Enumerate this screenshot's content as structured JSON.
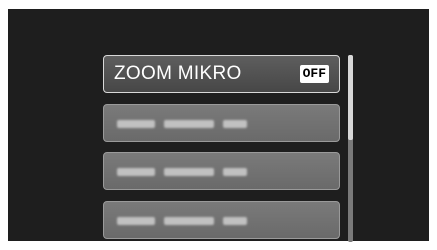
{
  "menu": {
    "items": [
      {
        "label": "ZOOM MIKRO",
        "value": "OFF",
        "selected": true
      },
      {
        "label": "",
        "selected": false
      },
      {
        "label": "",
        "selected": false
      },
      {
        "label": "",
        "selected": false
      }
    ]
  },
  "scrollbar": {
    "position_fraction": 0.0,
    "visible_fraction": 0.45
  },
  "colors": {
    "screen_background": "#1e1e1e",
    "selected_item": "#525252",
    "dim_item": "#727272",
    "badge_background": "#ffffff"
  },
  "icons": [
    "off-badge-icon"
  ]
}
